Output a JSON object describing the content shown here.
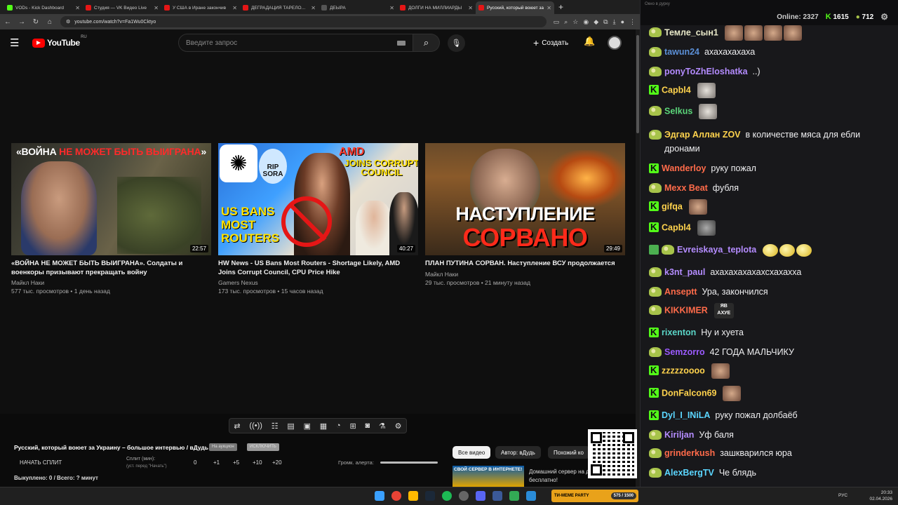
{
  "browser": {
    "tabs": [
      {
        "title": "VODs - Kick Dashboard",
        "color": "#53fc18"
      },
      {
        "title": "Студия — VK Видео Live",
        "color": "#e51616"
      },
      {
        "title": "У США в Иране закончив",
        "color": "#e51616"
      },
      {
        "title": "ДЕГРАДАЦИЯ ТАРЕЛОЧНИ",
        "color": "#e51616"
      },
      {
        "title": "ДЕЫРА",
        "color": "#555555"
      },
      {
        "title": "ДОЛГИ НА МИЛЛИАРДЫ",
        "color": "#e51616"
      },
      {
        "title": "Русский, который воюет за",
        "color": "#e51616"
      }
    ],
    "url": "youtube.com/watch?v=Fa1Wu0Cktyo"
  },
  "youtube": {
    "logo": "YouTube",
    "region": "RU",
    "search_placeholder": "Введите запрос",
    "create_label": "Создать",
    "videos": [
      {
        "thumb_caption_white_1": "«ВОЙНА ",
        "thumb_caption_red": "НЕ МОЖЕТ БЫТЬ ВЫИГРАНА",
        "thumb_caption_white_2": "»",
        "duration": "22:57",
        "title": "«ВОЙНА НЕ МОЖЕТ БЫТЬ ВЫИГРАНА». Солдаты и военкоры призывают прекращать войну",
        "channel": "Майкл Наки",
        "meta": "577 тыс. просмотров • 1 день назад"
      },
      {
        "thumb_amd": "AMD",
        "thumb_joins": "JOINS CORRUPT COUNCIL",
        "thumb_rip": "RIP SORA",
        "thumb_bans": "US BANS MOST ROUTERS",
        "duration": "40:27",
        "title": "HW News - US Bans Most Routers - Shortage Likely, AMD Joins Corrupt Council, CPU Price Hike",
        "channel": "Gamers Nexus",
        "meta": "173 тыс. просмотров • 15 часов назад"
      },
      {
        "thumb_line1": "НАСТУПЛЕНИЕ",
        "thumb_line2": "СОРВАНО",
        "duration": "29:49",
        "title": "ПЛАН ПУТИНА СОРВАН. Наступление ВСУ продолжается",
        "channel": "Майкл Наки",
        "meta": "29 тыс. просмотров • 21 минуту назад"
      }
    ]
  },
  "panel": {
    "stream_title": "Русский, который воюет за Украину – большое интервью / вДудь",
    "pill1": "На аукцион",
    "pill2": "ИСКЛЮЧИТЬ",
    "start_split": "НАЧАТЬ СПЛИТ",
    "split_label": "Сплит (мин):",
    "split_hint": "(уст. перед \"Начать\")",
    "split_values": [
      "0",
      "+1",
      "+5",
      "+10",
      "+20"
    ],
    "buy_info": "Выкуплено: 0 / Всего: ? минут",
    "alert_volume": "Громк. алерта:",
    "chips": [
      "Все видео",
      "Автор: вДудь",
      "Похожий ко"
    ],
    "rec_thumb_text": "СВОЙ СЕРВЕР В ИНТЕРНЕТЕ!",
    "rec_text": "Домашний сервер на динамическом IP бесплатно!"
  },
  "chat": {
    "window_title": "Окно в дурку",
    "online_label": "Online:",
    "online_value": "2327",
    "kick_value": "1615",
    "pepe_value": "712",
    "messages": [
      {
        "badge": "pepe",
        "nick": "Темле_сын1",
        "color": "#e8e8c8",
        "text": "",
        "emotes": [
          "face",
          "face",
          "face",
          "face"
        ]
      },
      {
        "badge": "pepe",
        "nick": "tawun24",
        "color": "#5b8fd6",
        "text": "ахахахахаха",
        "emotes": []
      },
      {
        "badge": "pepe",
        "nick": "ponyToZhEloshatka",
        "color": "#b48cff",
        "text": "..)",
        "emotes": []
      },
      {
        "badge": "kick",
        "nick": "Capbl4",
        "color": "#ffd34d",
        "text": "",
        "emotes": [
          "cat"
        ]
      },
      {
        "badge": "pepe",
        "nick": "Selkus",
        "color": "#5bd67a",
        "text": "",
        "emotes": [
          "cat"
        ]
      },
      {
        "badge": "pepe",
        "nick": "Эдгар Аллан ZOV",
        "color": "#ffd34d",
        "text": "в количестве мяса для ебли дронами",
        "emotes": []
      },
      {
        "badge": "kick",
        "nick": "Wanderloy",
        "color": "#ff6b4a",
        "text": "руку пожал",
        "emotes": []
      },
      {
        "badge": "pepe",
        "nick": "Mexx Beat",
        "color": "#ff6b4a",
        "text": "фубля",
        "emotes": []
      },
      {
        "badge": "kick",
        "nick": "gifqa",
        "color": "#ffd34d",
        "text": "",
        "emotes": [
          "face"
        ]
      },
      {
        "badge": "kick",
        "nick": "Capbl4",
        "color": "#ffd34d",
        "text": "",
        "emotes": [
          "fish"
        ]
      },
      {
        "badge": "pen",
        "nick": "Evreiskaya_teplota",
        "color": "#b48cff",
        "text": "",
        "emotes": [
          "egg",
          "egg",
          "egg"
        ]
      },
      {
        "badge": "pepe",
        "nick": "k3nt_paul",
        "color": "#b48cff",
        "text": "ахахахахахахсхахахха",
        "emotes": []
      },
      {
        "badge": "pepe",
        "nick": "Anseptt",
        "color": "#ff6b4a",
        "text": "Ура, закончился",
        "emotes": []
      },
      {
        "badge": "pepe",
        "nick": "KIKKIMER",
        "color": "#ff6b4a",
        "text": "",
        "emotes": [
          "txt"
        ]
      },
      {
        "badge": "kick",
        "nick": "rixenton",
        "color": "#5bd6c8",
        "text": "Ну и хуета",
        "emotes": []
      },
      {
        "badge": "pepe",
        "nick": "Semzorro",
        "color": "#9b5bff",
        "text": "42 ГОДА МАЛЬЧИКУ",
        "emotes": []
      },
      {
        "badge": "kick",
        "nick": "zzzzzoooo",
        "color": "#ffd34d",
        "text": "",
        "emotes": [
          "face"
        ]
      },
      {
        "badge": "kick",
        "nick": "DonFalcon69",
        "color": "#ffd34d",
        "text": "",
        "emotes": [
          "face"
        ]
      },
      {
        "badge": "kick",
        "nick": "Dyl_I_INiLA",
        "color": "#5bd6ff",
        "text": "руку пожал долбаёб",
        "emotes": []
      },
      {
        "badge": "pepe",
        "nick": "Kiriljan",
        "color": "#b48cff",
        "text": "Уф баля",
        "emotes": []
      },
      {
        "badge": "pepe",
        "nick": "grinderkush",
        "color": "#ff6b4a",
        "text": "зашкварился юра",
        "emotes": []
      },
      {
        "badge": "pepe",
        "nick": "AlexBergTV",
        "color": "#5bd6ff",
        "text": "Че блядь",
        "emotes": []
      }
    ]
  },
  "emote_text": "ЯВ АХУЕ",
  "taskbar": {
    "mid_label": "ТИ-MEME PARTY",
    "mid_counter": "575 / 1500",
    "lang": "РУС",
    "time": "20:33",
    "date": "02.04.2026"
  }
}
